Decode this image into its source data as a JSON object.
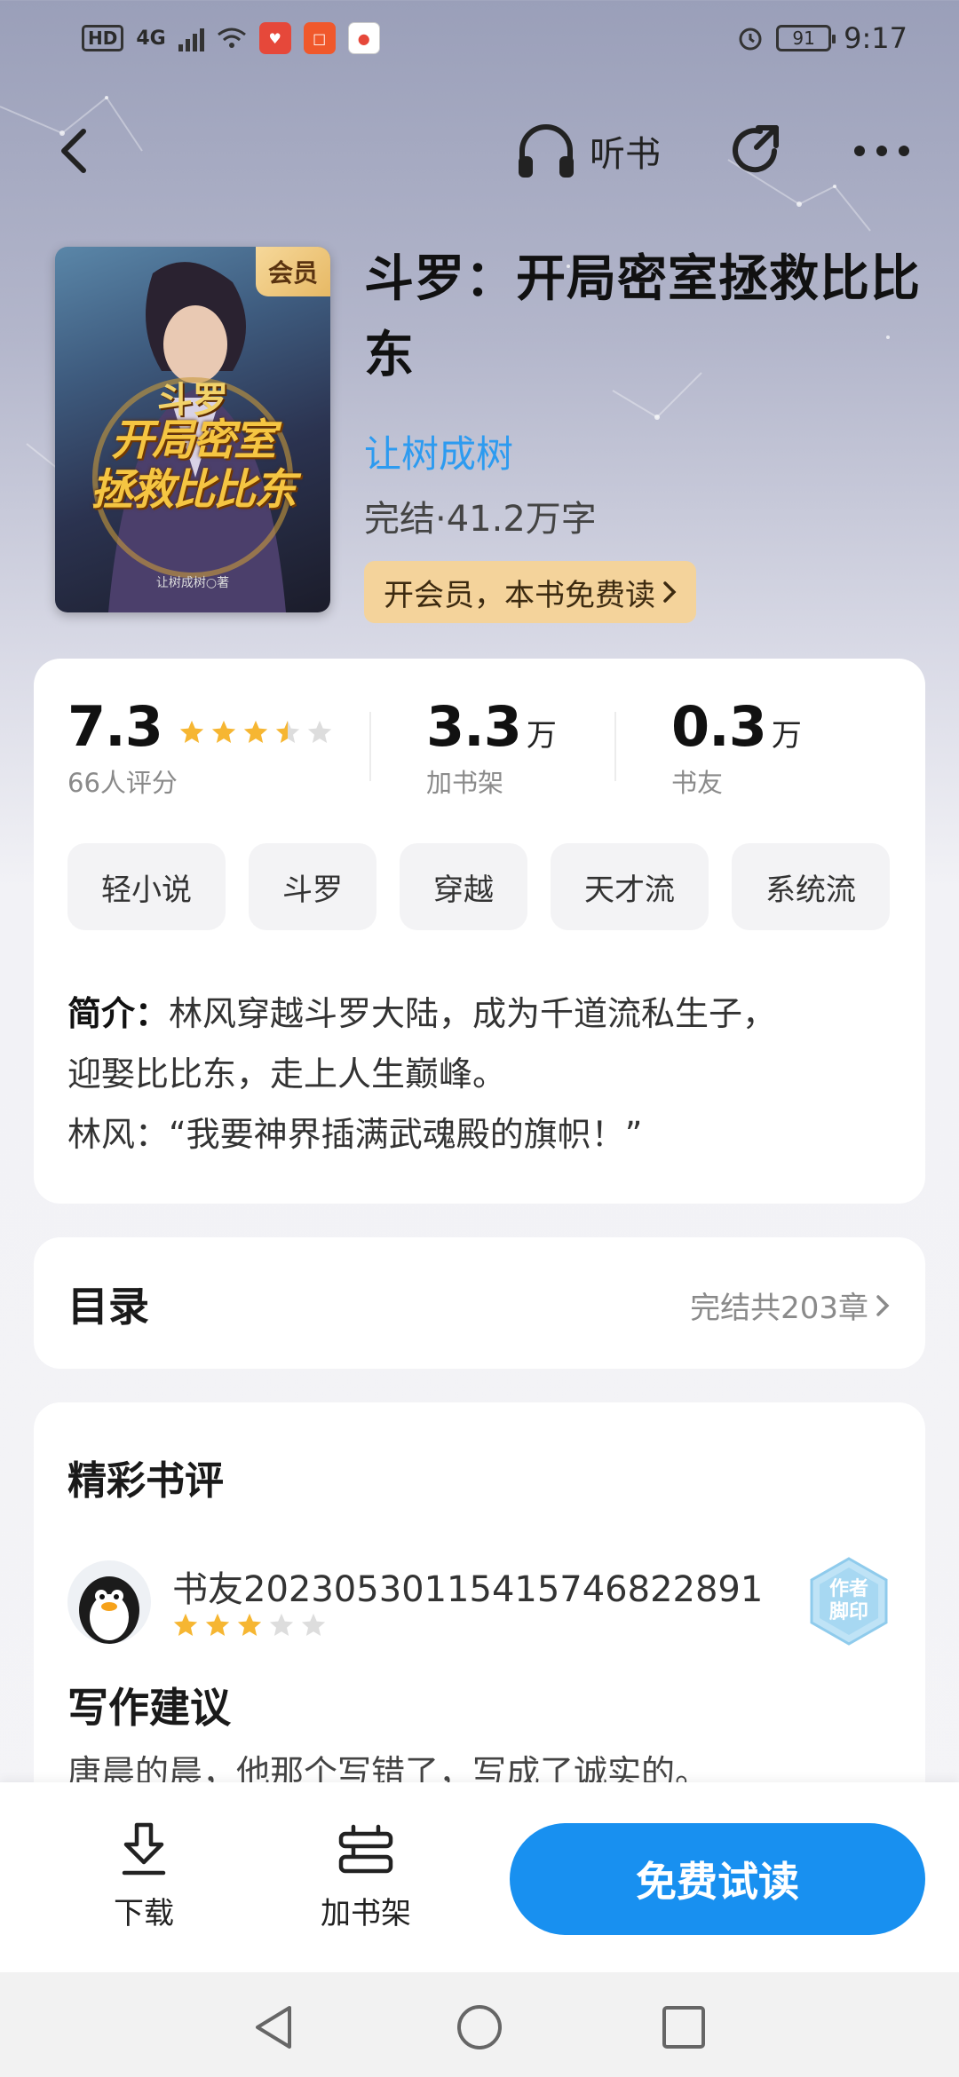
{
  "status_bar": {
    "hd": "HD",
    "network": "4G",
    "app_icons": [
      {
        "name": "app-icon-1",
        "color": "#e6483a"
      },
      {
        "name": "app-icon-2",
        "color": "#f0582b"
      },
      {
        "name": "app-icon-3",
        "color": "#ffffff"
      }
    ],
    "battery": "91",
    "time": "9:17"
  },
  "nav": {
    "listen_label": "听书",
    "icons": [
      "back-icon",
      "headphones-icon",
      "share-icon",
      "more-icon"
    ]
  },
  "book": {
    "cover_badge": "会员",
    "cover_series": "斗罗",
    "cover_title_line1": "开局密室",
    "cover_title_line2": "拯救比比东",
    "cover_author": "让树成树○著",
    "title": "斗罗：开局密室拯救比比东",
    "author": "让树成树",
    "meta": "完结·41.2万字",
    "vip_label": "开会员，本书免费读"
  },
  "stats": {
    "rating": "7.3",
    "rating_stars": 3.5,
    "rating_count": "66人评分",
    "shelf_num": "3.3",
    "shelf_unit": "万",
    "shelf_label": "加书架",
    "friends_num": "0.3",
    "friends_unit": "万",
    "friends_label": "书友"
  },
  "tags": [
    "轻小说",
    "斗罗",
    "穿越",
    "天才流",
    "系统流"
  ],
  "intro": {
    "label": "简介：",
    "line1": "林风穿越斗罗大陆，成为千道流私生子，",
    "line2": "迎娶比比东，走上人生巅峰。",
    "line3": "林风：“我要神界插满武魂殿的旗帜！”"
  },
  "toc": {
    "title": "目录",
    "info": "完结共203章"
  },
  "reviews": {
    "heading": "精彩书评",
    "items": [
      {
        "user": "书友20230530115415746822891",
        "stars": 3,
        "badge": "作者脚印",
        "title": "写作建议",
        "body": "唐晨的晨，他那个写错了，写成了诚实的。"
      }
    ]
  },
  "actions": {
    "download": "下载",
    "add_shelf": "加书架",
    "read": "免费试读"
  },
  "colors": {
    "accent": "#1890f0",
    "author_link": "#2d9bf0",
    "star": "#f6b632",
    "vip_bg": "#f4d39b"
  }
}
